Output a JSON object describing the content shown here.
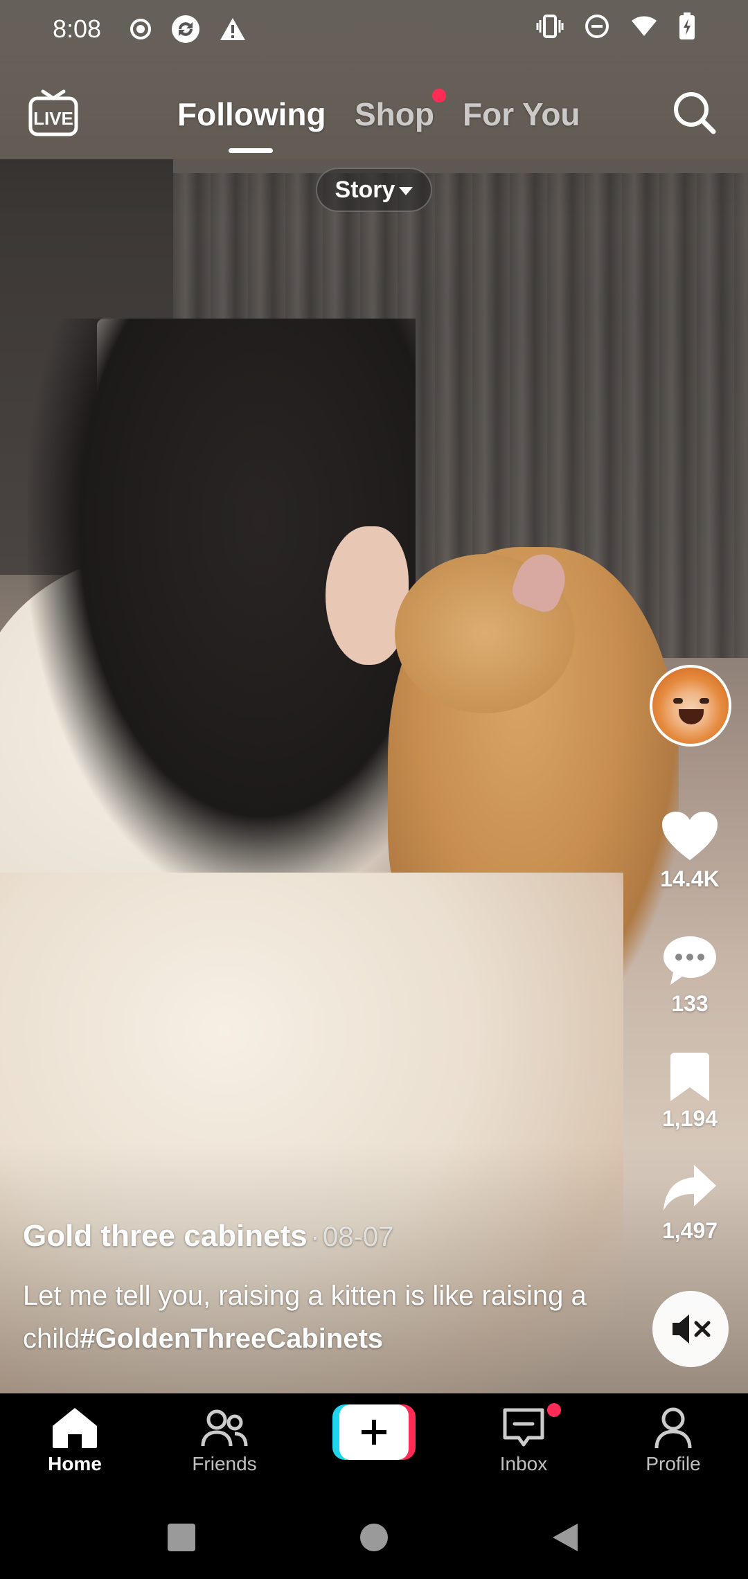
{
  "status_bar": {
    "time": "8:08",
    "left_icons": [
      "record-icon",
      "sync-icon",
      "warning-icon"
    ],
    "right_icons": [
      "vibrate-icon",
      "do-not-disturb-icon",
      "wifi-icon",
      "battery-icon"
    ]
  },
  "top_nav": {
    "live_label": "LIVE",
    "tabs": [
      {
        "label": "Following",
        "active": true
      },
      {
        "label": "Shop",
        "active": false,
        "notification_dot": true
      },
      {
        "label": "For You",
        "active": false
      }
    ],
    "search_icon": "search-icon",
    "story_pill": "Story"
  },
  "post": {
    "author": "Gold three cabinets",
    "date_separator": "·",
    "date": "08-07",
    "description": "Let me tell you, raising a kitten is like raising a child",
    "hashtag": "#GoldenThreeCabinets"
  },
  "actions": {
    "likes": "14.4K",
    "comments": "133",
    "saves": "1,194",
    "shares": "1,497"
  },
  "bottom_nav": {
    "items": [
      {
        "label": "Home",
        "icon": "home-icon",
        "active": true
      },
      {
        "label": "Friends",
        "icon": "friends-icon",
        "active": false
      },
      {
        "label": "",
        "icon": "plus-icon",
        "active": false
      },
      {
        "label": "Inbox",
        "icon": "inbox-icon",
        "active": false,
        "notification_dot": true
      },
      {
        "label": "Profile",
        "icon": "profile-icon",
        "active": false
      }
    ]
  },
  "colors": {
    "accent_red": "#fe2c55",
    "accent_cyan": "#20d5ec"
  }
}
